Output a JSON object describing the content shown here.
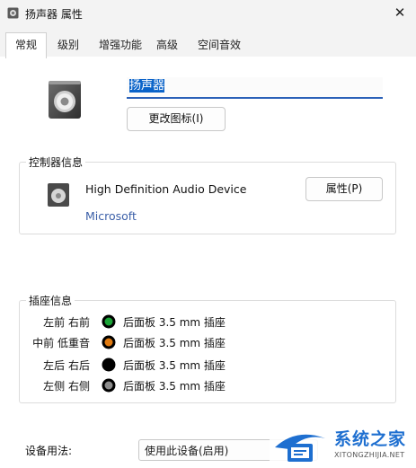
{
  "window": {
    "title": "扬声器 属性",
    "close_glyph": "✕"
  },
  "tabs": [
    {
      "label": "常规",
      "active": true
    },
    {
      "label": "级别",
      "active": false
    },
    {
      "label": "增强功能",
      "active": false
    },
    {
      "label": "高级",
      "active": false
    },
    {
      "label": "空间音效",
      "active": false
    }
  ],
  "general": {
    "device_name_value": "扬声器",
    "change_icon_button": "更改图标(I)",
    "controller": {
      "group_label": "控制器信息",
      "device_name": "High Definition Audio Device",
      "vendor": "Microsoft",
      "properties_button": "属性(P)"
    },
    "jack": {
      "group_label": "插座信息",
      "rows": [
        {
          "label": "左前 右前",
          "description": "后面板 3.5 mm 插座",
          "color": "#1aa336"
        },
        {
          "label": "中前 低重音",
          "description": "后面板 3.5 mm 插座",
          "color": "#e07a10"
        },
        {
          "label": "左后 右后",
          "description": "后面板 3.5 mm 插座",
          "color": "#000000"
        },
        {
          "label": "左侧 右侧",
          "description": "后面板 3.5 mm 插座",
          "color": "#8c8c8c"
        }
      ]
    },
    "device_usage": {
      "label": "设备用法:",
      "selected": "使用此设备(启用)"
    }
  },
  "watermark": {
    "brand": "系统之家",
    "url": "XITONGZHIJIA.NET"
  },
  "colors": {
    "accent": "#0a63c9",
    "vendor_link": "#3b5fa8",
    "watermark": "#1e6fd0"
  }
}
